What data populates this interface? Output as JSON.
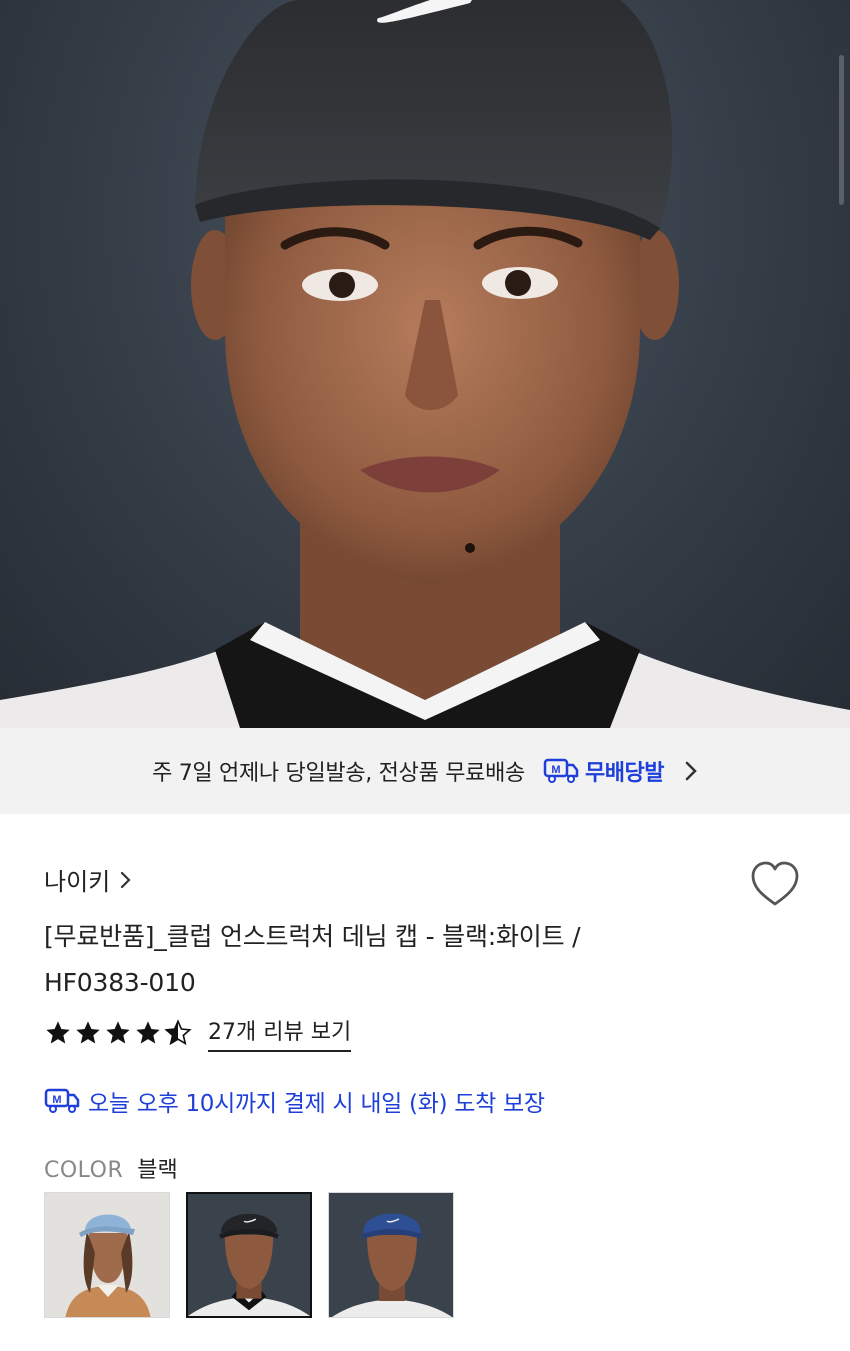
{
  "banner": {
    "text": "주 7일 언제나 당일발송, 전상품 무료배송",
    "badge_label": "무배당발",
    "badge_icon": "delivery-truck-icon",
    "arrow_icon": "chevron-right-icon"
  },
  "product": {
    "brand": "나이키",
    "title_line1": "[무료반품]_클럽 언스트럭처 데님 캡 - 블랙:화이트 /",
    "title_line2": "HF0383-010",
    "rating_value": 4.5,
    "review_link": "27개 리뷰 보기",
    "delivery_guarantee": "오늘 오후 10시까지 결제 시 내일 (화) 도착 보장",
    "color_label": "COLOR",
    "color_value": "블랙",
    "swatches": [
      {
        "name": "light-blue",
        "selected": false
      },
      {
        "name": "black",
        "selected": true
      },
      {
        "name": "navy-blue",
        "selected": false
      }
    ]
  },
  "colors": {
    "accent_blue": "#1f3fdb",
    "banner_bg": "#f2f2f2",
    "text_dark": "#222222"
  }
}
